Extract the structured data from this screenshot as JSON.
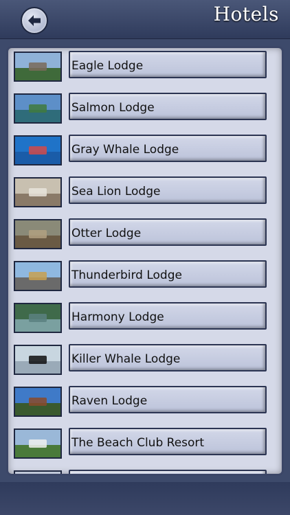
{
  "header": {
    "title": "Hotels",
    "back_icon": "arrow-left-icon"
  },
  "hotels": [
    {
      "name": "Eagle Lodge",
      "sky": "#8fb2d8",
      "ground": "#3f6a3a",
      "spot": "#7a6a5a"
    },
    {
      "name": "Salmon Lodge",
      "sky": "#5d8fc8",
      "ground": "#2f6c7a",
      "spot": "#3f7a3e"
    },
    {
      "name": "Gray Whale Lodge",
      "sky": "#1f73c8",
      "ground": "#1a5ca8",
      "spot": "#d24a4a"
    },
    {
      "name": "Sea Lion Lodge",
      "sky": "#c8c0b0",
      "ground": "#8a7a68",
      "spot": "#e8e4dc"
    },
    {
      "name": "Otter Lodge",
      "sky": "#8a8a78",
      "ground": "#6a5a44",
      "spot": "#b0a080"
    },
    {
      "name": "Thunderbird Lodge",
      "sky": "#8fb8e0",
      "ground": "#6a6a6a",
      "spot": "#c8a050"
    },
    {
      "name": "Harmony Lodge",
      "sky": "#3f6a4a",
      "ground": "#7aa0a0",
      "spot": "#5a8080"
    },
    {
      "name": "Killer Whale Lodge",
      "sky": "#c8d6e0",
      "ground": "#9aaab8",
      "spot": "#111111"
    },
    {
      "name": "Raven Lodge",
      "sky": "#3f7ac8",
      "ground": "#3a5a2e",
      "spot": "#8a4a2a"
    },
    {
      "name": "The Beach Club Resort",
      "sky": "#9ab8d8",
      "ground": "#4a7a3a",
      "spot": "#f0f0f0"
    },
    {
      "name": "",
      "sky": "#c0c8d8",
      "ground": "#c0c8d8",
      "spot": "#c0c8d8"
    }
  ]
}
